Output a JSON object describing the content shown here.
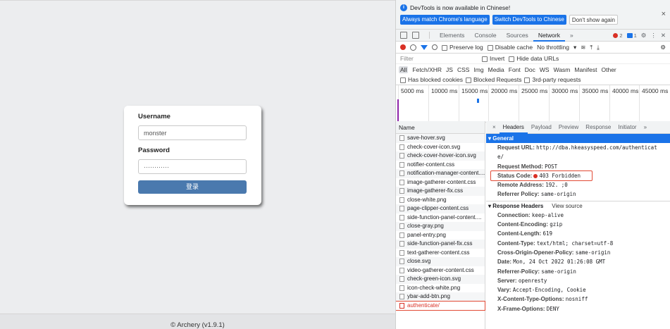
{
  "login": {
    "username_label": "Username",
    "username_value": "monster",
    "password_label": "Password",
    "password_value": "············",
    "submit_label": "登录"
  },
  "footer": {
    "text": "© Archery (v1.9.1)"
  },
  "devtools": {
    "banner": {
      "message": "DevTools is now available in Chinese!",
      "btn_match": "Always match Chrome's language",
      "btn_switch": "Switch DevTools to Chinese",
      "btn_dont": "Don't show again",
      "close": "×"
    },
    "tabs": [
      "Elements",
      "Console",
      "Sources",
      "Network",
      "»"
    ],
    "errors_count": "2",
    "messages_count": "1",
    "toolbar": {
      "preserve_log": "Preserve log",
      "disable_cache": "Disable cache",
      "throttling": "No throttling"
    },
    "filter": {
      "placeholder": "Filter",
      "invert": "Invert",
      "hide_data_urls": "Hide data URLs"
    },
    "types": [
      "All",
      "Fetch/XHR",
      "JS",
      "CSS",
      "Img",
      "Media",
      "Font",
      "Doc",
      "WS",
      "Wasm",
      "Manifest",
      "Other"
    ],
    "blocked": {
      "has_blocked_cookies": "Has blocked cookies",
      "blocked_requests": "Blocked Requests",
      "third_party": "3rd-party requests"
    },
    "timeline_ticks": [
      "5000 ms",
      "10000 ms",
      "15000 ms",
      "20000 ms",
      "25000 ms",
      "30000 ms",
      "35000 ms",
      "40000 ms",
      "45000 ms"
    ],
    "name_header": "Name",
    "files": [
      "save-hover.svg",
      "check-cover-icon.svg",
      "check-cover-hover-icon.svg",
      "notifier-content.css",
      "notification-manager-content....",
      "image-gatherer-content.css",
      "image-gatherer-fix.css",
      "close-white.png",
      "page-clipper-content.css",
      "side-function-panel-content....",
      "close-gray.png",
      "panel-entry.png",
      "side-function-panel-fix.css",
      "text-gatherer-content.css",
      "close.svg",
      "video-gatherer-content.css",
      "check-green-icon.svg",
      "icon-check-white.png",
      "ybar-add-btn.png",
      "authenticate/"
    ],
    "detail_tabs": [
      "×",
      "Headers",
      "Payload",
      "Preview",
      "Response",
      "Initiator",
      "»"
    ],
    "general": {
      "title": "▾ General",
      "request_url_key": "Request URL:",
      "request_url_val": "http://dba.hkeasyspeed.com/authenticat",
      "request_url_val2": "e/",
      "method_key": "Request Method:",
      "method_val": "POST",
      "status_key": "Status Code:",
      "status_val": "403 Forbidden",
      "remote_key": "Remote Address:",
      "remote_val": "192.            ;0",
      "referrer_key": "Referrer Policy:",
      "referrer_val": "same-origin"
    },
    "response_headers": {
      "title": "▾ Response Headers",
      "view_source": "View source",
      "items": [
        {
          "k": "Connection:",
          "v": "keep-alive"
        },
        {
          "k": "Content-Encoding:",
          "v": "gzip"
        },
        {
          "k": "Content-Length:",
          "v": "619"
        },
        {
          "k": "Content-Type:",
          "v": "text/html; charset=utf-8"
        },
        {
          "k": "Cross-Origin-Opener-Policy:",
          "v": "same-origin"
        },
        {
          "k": "Date:",
          "v": "Mon, 24 Oct 2022 01:26:08 GMT"
        },
        {
          "k": "Referrer-Policy:",
          "v": "same-origin"
        },
        {
          "k": "Server:",
          "v": "openresty"
        },
        {
          "k": "Vary:",
          "v": "Accept-Encoding, Cookie"
        },
        {
          "k": "X-Content-Type-Options:",
          "v": "nosniff"
        },
        {
          "k": "X-Frame-Options:",
          "v": "DENY"
        }
      ]
    }
  }
}
